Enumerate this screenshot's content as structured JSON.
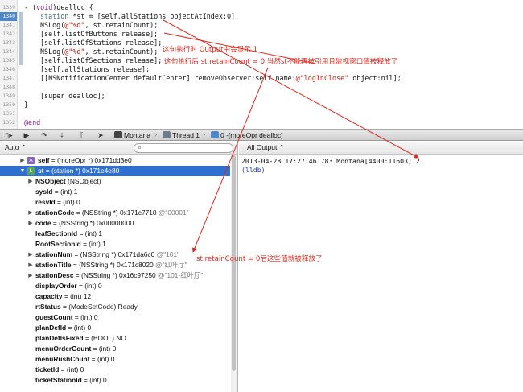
{
  "editor": {
    "line_numbers": [
      "1339",
      "1340",
      "1341",
      "1342",
      "1343",
      "1344",
      "1345",
      "1346",
      "1347",
      "1348",
      "1349",
      "1350",
      "1351",
      "1352",
      "1353"
    ],
    "current_line": "1340",
    "code": {
      "l1339": "- (void)dealloc {",
      "l1340_kw": "station",
      "l1340_rest": " *st = [self.allStations objectAtIndex:0];",
      "l1341_fn": "NSLog(",
      "l1341_str": "@\"%d\"",
      "l1341_rest": ", st.retainCount);",
      "l1342": "[self.listOfButtons release];",
      "l1343": "[self.listOfStations release];",
      "l1344_fn": "NSLog(",
      "l1344_str": "@\"%d\"",
      "l1344_rest": ", st.retainCount);",
      "l1345": "[self.listOfSections release];",
      "l1346": "[self.allStations release];",
      "l1347_a": "[[NSNotificationCenter defaultCenter] removeObserver:self name:",
      "l1347_str": "@\"logInClose\"",
      "l1347_b": " object:nil];",
      "l1349": "[super dealloc];",
      "l1350": "}",
      "l1353": "@end"
    },
    "annotations": {
      "a1": "这句执行时 Output中会显示 1",
      "a2": "这句执行后 st.retainCount = 0,当然st不能再被引用且监视窗口值被释放了",
      "a3": "st.retainCount = 0后这些值就被释放了"
    }
  },
  "debugbar": {
    "buttons": [
      "pause-icon",
      "step-over-icon",
      "step-in-icon",
      "step-out-icon",
      "location-icon"
    ],
    "crumbs": {
      "target": "Montana",
      "thread": "Thread 1",
      "frame": "0 -[moreOpr dealloc]"
    }
  },
  "variables": {
    "scope": "Auto ⌃",
    "search_placeholder": "",
    "rows": [
      {
        "name": "self",
        "value": " = (moreOpr *) 0x171dd3e0",
        "summary": ""
      },
      {
        "name": "st",
        "value": " = (station *) 0x171e4e80",
        "summary": ""
      },
      {
        "name": "NSObject",
        "value": " (NSObject)",
        "summary": ""
      },
      {
        "name": "sysId",
        "value": " = (int) 1",
        "summary": ""
      },
      {
        "name": "resvId",
        "value": " = (int) 0",
        "summary": ""
      },
      {
        "name": "stationCode",
        "value": " = (NSString *) 0x171c7710 ",
        "summary": "@\"00001\""
      },
      {
        "name": "code",
        "value": " = (NSString *) 0x00000000",
        "summary": ""
      },
      {
        "name": "leafSectionId",
        "value": " = (int) 1",
        "summary": ""
      },
      {
        "name": "RootSectionId",
        "value": " = (int) 1",
        "summary": ""
      },
      {
        "name": "stationNum",
        "value": " = (NSString *) 0x171da6c0 ",
        "summary": "@\"101\""
      },
      {
        "name": "stationTitle",
        "value": " = (NSString *) 0x171c8020 ",
        "summary": "@\"红叶厅\""
      },
      {
        "name": "stationDesc",
        "value": " = (NSString *) 0x16c97250 ",
        "summary": "@\"101-红叶厅\""
      },
      {
        "name": "displayOrder",
        "value": " = (int) 0",
        "summary": ""
      },
      {
        "name": "capacity",
        "value": " = (int) 12",
        "summary": ""
      },
      {
        "name": "rtStatus",
        "value": " = (ModeSetCode) Ready",
        "summary": ""
      },
      {
        "name": "guestCount",
        "value": " = (int) 0",
        "summary": ""
      },
      {
        "name": "planDefId",
        "value": " = (int) 0",
        "summary": ""
      },
      {
        "name": "planDefIsFixed",
        "value": " = (BOOL) NO",
        "summary": ""
      },
      {
        "name": "menuOrderCount",
        "value": " = (int) 0",
        "summary": ""
      },
      {
        "name": "menuRushCount",
        "value": " = (int) 0",
        "summary": ""
      },
      {
        "name": "ticketId",
        "value": " = (int) 0",
        "summary": ""
      },
      {
        "name": "ticketStationId",
        "value": " = (int) 0",
        "summary": ""
      }
    ]
  },
  "console": {
    "filter": "All Output ⌃",
    "lines": [
      "2013-04-28 17:27:46.783 Montana[4400:11603] 2",
      "(lldb)"
    ]
  },
  "colors": {
    "selection": "#2f6fd0",
    "annotation": "#e0261b",
    "current_line": "#4e86c8"
  }
}
